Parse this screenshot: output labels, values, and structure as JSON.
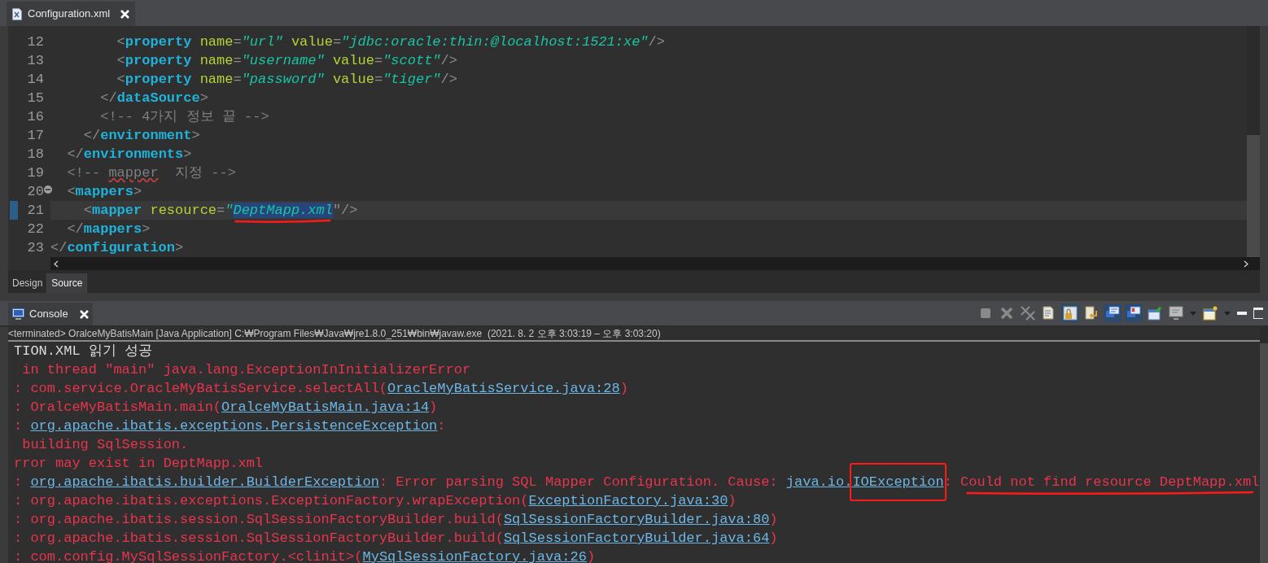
{
  "editor": {
    "tab": {
      "title": "Configuration.xml",
      "selected": true
    },
    "lines": [
      {
        "number": "12",
        "current": false,
        "foldable": false,
        "tokens": [
          {
            "kind": "punct",
            "text": "        <"
          },
          {
            "kind": "tag",
            "text": "property"
          },
          {
            "kind": "attr",
            "text": " name"
          },
          {
            "kind": "punct",
            "text": "="
          },
          {
            "kind": "value",
            "text": "\"url\""
          },
          {
            "kind": "attr",
            "text": " value"
          },
          {
            "kind": "punct",
            "text": "="
          },
          {
            "kind": "value",
            "text": "\"jdbc:oracle:thin:@localhost:1521:xe\""
          },
          {
            "kind": "punct",
            "text": "/>"
          }
        ]
      },
      {
        "number": "13",
        "current": false,
        "foldable": false,
        "tokens": [
          {
            "kind": "punct",
            "text": "        <"
          },
          {
            "kind": "tag",
            "text": "property"
          },
          {
            "kind": "attr",
            "text": " name"
          },
          {
            "kind": "punct",
            "text": "="
          },
          {
            "kind": "value",
            "text": "\"username\""
          },
          {
            "kind": "attr",
            "text": " value"
          },
          {
            "kind": "punct",
            "text": "="
          },
          {
            "kind": "value",
            "text": "\"scott\""
          },
          {
            "kind": "punct",
            "text": "/>"
          }
        ]
      },
      {
        "number": "14",
        "current": false,
        "foldable": false,
        "tokens": [
          {
            "kind": "punct",
            "text": "        <"
          },
          {
            "kind": "tag",
            "text": "property"
          },
          {
            "kind": "attr",
            "text": " name"
          },
          {
            "kind": "punct",
            "text": "="
          },
          {
            "kind": "value",
            "text": "\"password\""
          },
          {
            "kind": "attr",
            "text": " value"
          },
          {
            "kind": "punct",
            "text": "="
          },
          {
            "kind": "value",
            "text": "\"tiger\""
          },
          {
            "kind": "punct",
            "text": "/>"
          }
        ]
      },
      {
        "number": "15",
        "current": false,
        "foldable": false,
        "tokens": [
          {
            "kind": "punct",
            "text": "      </"
          },
          {
            "kind": "tag",
            "text": "dataSource"
          },
          {
            "kind": "punct",
            "text": ">"
          }
        ]
      },
      {
        "number": "16",
        "current": false,
        "foldable": false,
        "tokens": [
          {
            "kind": "comment",
            "text": "      <!-- 4가지 정보 끝 -->"
          }
        ]
      },
      {
        "number": "17",
        "current": false,
        "foldable": false,
        "tokens": [
          {
            "kind": "punct",
            "text": "    </"
          },
          {
            "kind": "tag",
            "text": "environment"
          },
          {
            "kind": "punct",
            "text": ">"
          }
        ]
      },
      {
        "number": "18",
        "current": false,
        "foldable": false,
        "tokens": [
          {
            "kind": "punct",
            "text": "  </"
          },
          {
            "kind": "tag",
            "text": "environments"
          },
          {
            "kind": "punct",
            "text": ">"
          }
        ]
      },
      {
        "number": "19",
        "current": false,
        "foldable": false,
        "tokens": [
          {
            "kind": "comment",
            "text": "  <!-- "
          },
          {
            "kind": "misspelled",
            "text": "mapper"
          },
          {
            "kind": "comment",
            "text": "  지정 -->"
          }
        ]
      },
      {
        "number": "20",
        "current": false,
        "foldable": true,
        "tokens": [
          {
            "kind": "punct",
            "text": "  <"
          },
          {
            "kind": "tag",
            "text": "mappers"
          },
          {
            "kind": "punct",
            "text": ">"
          }
        ]
      },
      {
        "number": "21",
        "current": true,
        "foldable": false,
        "tokens": [
          {
            "kind": "punct",
            "text": "    <"
          },
          {
            "kind": "tag",
            "text": "mapper"
          },
          {
            "kind": "attr",
            "text": " resource"
          },
          {
            "kind": "punct",
            "text": "="
          },
          {
            "kind": "value",
            "text": "\""
          },
          {
            "kind": "selection-underlined",
            "text": "DeptMapp.xml"
          },
          {
            "kind": "punct",
            "text": "\"/>"
          }
        ]
      },
      {
        "number": "22",
        "current": false,
        "foldable": false,
        "tokens": [
          {
            "kind": "punct",
            "text": "  </"
          },
          {
            "kind": "tag",
            "text": "mappers"
          },
          {
            "kind": "punct",
            "text": ">"
          }
        ]
      },
      {
        "number": "23",
        "current": false,
        "foldable": false,
        "tokens": [
          {
            "kind": "punct",
            "text": "</"
          },
          {
            "kind": "tag",
            "text": "configuration"
          },
          {
            "kind": "punct",
            "text": ">"
          }
        ]
      }
    ],
    "view_tabs": [
      {
        "label": "Design",
        "selected": false
      },
      {
        "label": "Source",
        "selected": true
      }
    ]
  },
  "console": {
    "tab": {
      "title": "Console",
      "selected": true
    },
    "toolbar": [
      {
        "kind": "stop",
        "pressed": false
      },
      {
        "kind": "remove",
        "pressed": false
      },
      {
        "kind": "remove-all",
        "pressed": false
      },
      {
        "kind": "clear",
        "pressed": false
      },
      {
        "kind": "scroll-lock",
        "pressed": true
      },
      {
        "kind": "word-wrap",
        "pressed": false
      },
      {
        "kind": "stdout",
        "pressed": true
      },
      {
        "kind": "stderr",
        "pressed": true
      },
      {
        "kind": "pin",
        "pressed": false
      },
      {
        "kind": "display",
        "pressed": false
      },
      {
        "kind": "caret",
        "pressed": false
      },
      {
        "kind": "new-console",
        "pressed": false
      },
      {
        "kind": "caret",
        "pressed": false
      },
      {
        "kind": "minimize",
        "pressed": false
      },
      {
        "kind": "maximize",
        "pressed": false
      }
    ],
    "process": "<terminated> OralceMyBatisMain [Java Application] C:₩Program Files₩Java₩jre1.8.0_251₩bin₩javaw.exe  (2021. 8. 2 오후 3:03:19 – 오후 3:03:20)",
    "lines": [
      [
        {
          "kind": "out",
          "text": "TION.XML 읽기 성공"
        }
      ],
      [
        {
          "kind": "err",
          "text": " in thread \"main\" java.lang.ExceptionInInitializerError"
        }
      ],
      [
        {
          "kind": "err",
          "text": ": com.service.OracleMyBatisService.selectAll("
        },
        {
          "kind": "link",
          "text": "OracleMyBatisService.java:28"
        },
        {
          "kind": "err",
          "text": ")"
        }
      ],
      [
        {
          "kind": "err",
          "text": ": OralceMyBatisMain.main("
        },
        {
          "kind": "link",
          "text": "OralceMyBatisMain.java:14"
        },
        {
          "kind": "err",
          "text": ")"
        }
      ],
      [
        {
          "kind": "err",
          "text": ": "
        },
        {
          "kind": "link",
          "text": "org.apache.ibatis.exceptions.PersistenceException"
        },
        {
          "kind": "err",
          "text": ":"
        }
      ],
      [
        {
          "kind": "err",
          "text": " building SqlSession."
        }
      ],
      [
        {
          "kind": "err",
          "text": "rror may exist in DeptMapp.xml"
        }
      ],
      [
        {
          "kind": "err",
          "text": ": "
        },
        {
          "kind": "link",
          "text": "org.apache.ibatis.builder.BuilderException"
        },
        {
          "kind": "err",
          "text": ": Error parsing SQL Mapper Configuration. Cause: "
        },
        {
          "kind": "link",
          "text": "java.io."
        },
        {
          "kind": "link-boxed",
          "text": "IOException"
        },
        {
          "kind": "err",
          "text": ": "
        },
        {
          "kind": "err-underlined",
          "text": "Could not find resource DeptMapp.xml"
        }
      ],
      [
        {
          "kind": "err",
          "text": ": org.apache.ibatis.exceptions.ExceptionFactory.wrapException("
        },
        {
          "kind": "link",
          "text": "ExceptionFactory.java:30"
        },
        {
          "kind": "err",
          "text": ")"
        }
      ],
      [
        {
          "kind": "err",
          "text": ": org.apache.ibatis.session.SqlSessionFactoryBuilder.build("
        },
        {
          "kind": "link",
          "text": "SqlSessionFactoryBuilder.java:80"
        },
        {
          "kind": "err",
          "text": ")"
        }
      ],
      [
        {
          "kind": "err",
          "text": ": org.apache.ibatis.session.SqlSessionFactoryBuilder.build("
        },
        {
          "kind": "link",
          "text": "SqlSessionFactoryBuilder.java:64"
        },
        {
          "kind": "err",
          "text": ")"
        }
      ],
      [
        {
          "kind": "err",
          "text": ": com.config.MySqlSessionFactory.<clinit>("
        },
        {
          "kind": "link",
          "text": "MySqlSessionFactory.java:26"
        },
        {
          "kind": "err",
          "text": ")"
        }
      ]
    ]
  }
}
